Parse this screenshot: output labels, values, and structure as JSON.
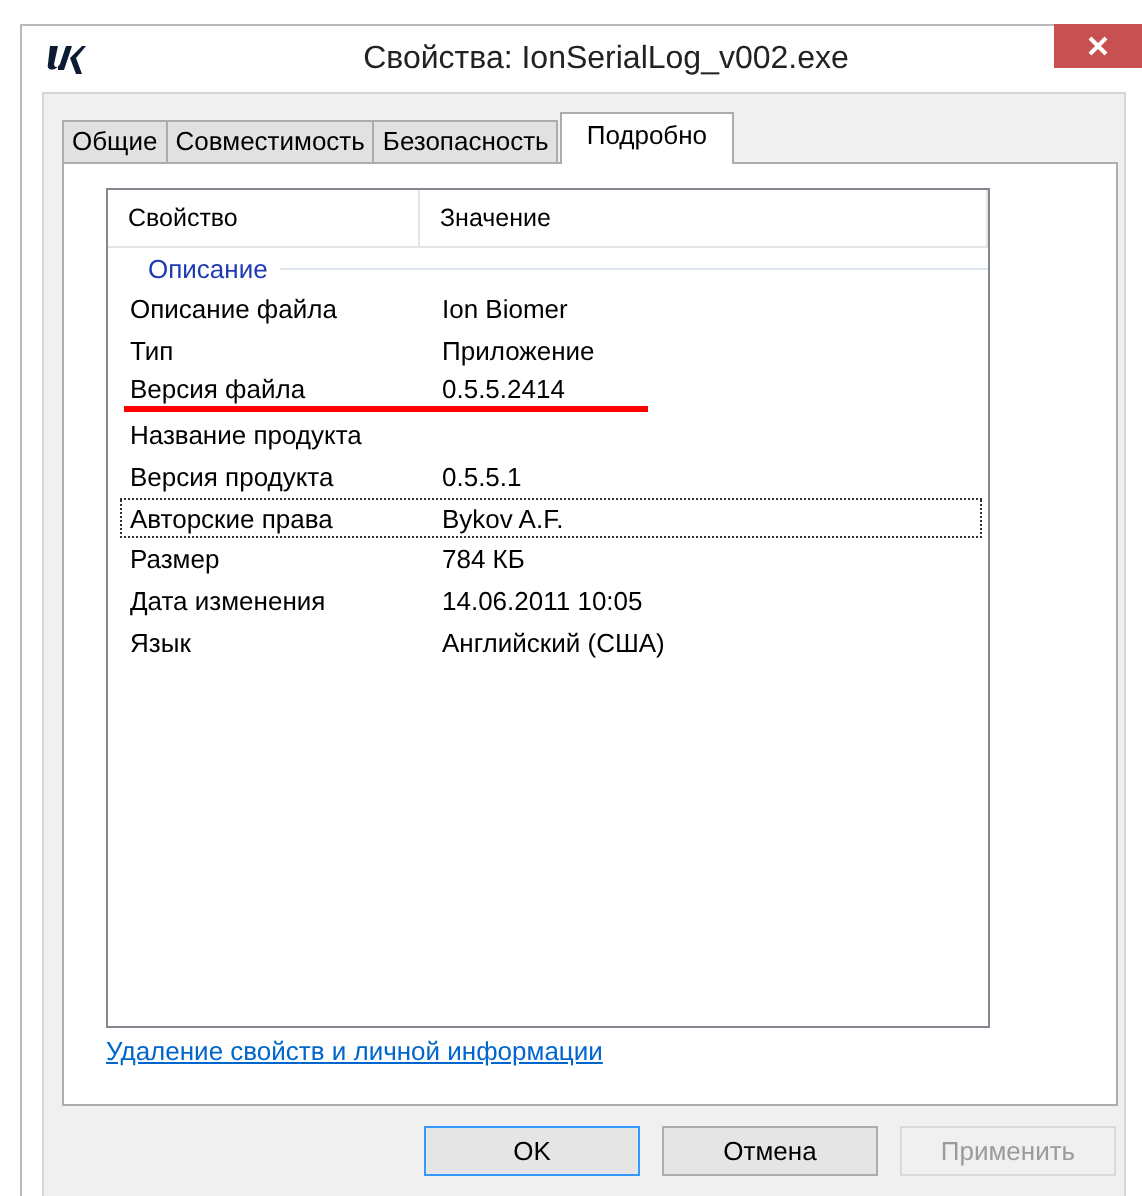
{
  "window": {
    "title": "Свойства: IonSerialLog_v002.exe"
  },
  "tabs": [
    {
      "label": "Общие",
      "selected": false
    },
    {
      "label": "Совместимость",
      "selected": false
    },
    {
      "label": "Безопасность",
      "selected": false
    },
    {
      "label": "Подробно",
      "selected": true
    }
  ],
  "table": {
    "columns": [
      "Свойство",
      "Значение"
    ],
    "groups": [
      {
        "title": "Описание",
        "rows": [
          {
            "property": "Описание файла",
            "value": "Ion Biomer",
            "focused": false,
            "marked": false
          },
          {
            "property": "Тип",
            "value": "Приложение",
            "focused": false,
            "marked": false
          },
          {
            "property": "Версия файла",
            "value": "0.5.5.2414",
            "focused": false,
            "marked": true
          },
          {
            "property": "Название продукта",
            "focused": false,
            "marked": false
          },
          {
            "property": "Версия продукта",
            "value": "0.5.5.1",
            "focused": false,
            "marked": false
          },
          {
            "property": "Авторские права",
            "value": "Bykov A.F.",
            "focused": true,
            "marked": false
          },
          {
            "property": "Размер",
            "value": "784 КБ",
            "focused": false,
            "marked": false
          },
          {
            "property": "Дата изменения",
            "value": "14.06.2011 10:05",
            "focused": false,
            "marked": false
          },
          {
            "property": "Язык",
            "value": "Английский (США)",
            "focused": false,
            "marked": false
          }
        ]
      }
    ]
  },
  "link": "Удаление свойств и личной информации",
  "buttons": [
    {
      "label": "OK",
      "default": true,
      "disabled": false
    },
    {
      "label": "Отмена",
      "default": false,
      "disabled": false
    },
    {
      "label": "Применить",
      "default": false,
      "disabled": true
    }
  ]
}
